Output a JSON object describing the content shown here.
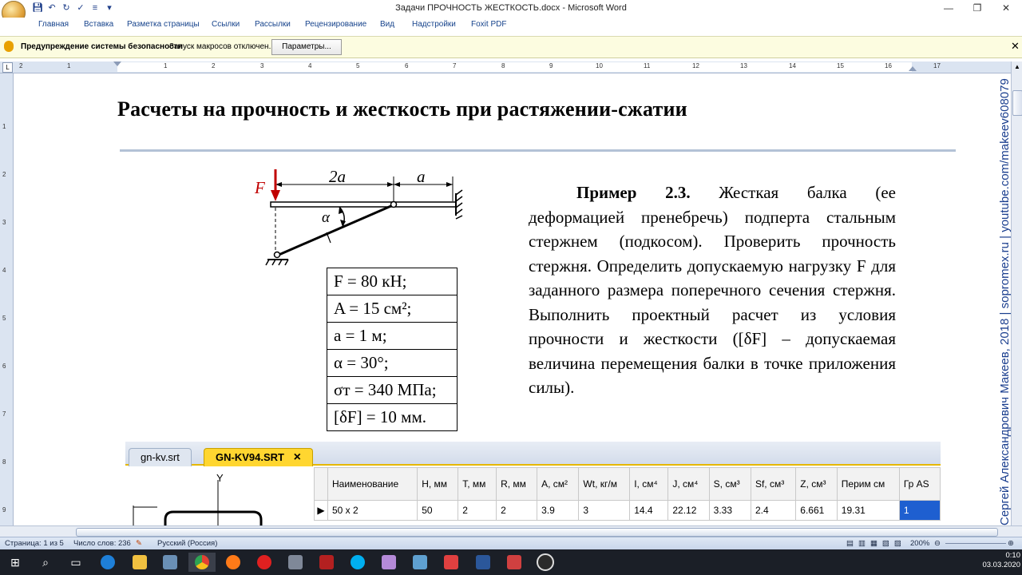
{
  "window": {
    "title": "Задачи ПРОЧНОСТЬ ЖЕСТКОСТЬ.docx - Microsoft Word"
  },
  "ribbon": {
    "tabs": [
      "Главная",
      "Вставка",
      "Разметка страницы",
      "Ссылки",
      "Рассылки",
      "Рецензирование",
      "Вид",
      "Надстройки",
      "Foxit PDF"
    ]
  },
  "security_bar": {
    "title": "Предупреждение системы безопасности",
    "message": "Запуск макросов отключен.",
    "button": "Параметры..."
  },
  "ruler": {
    "numbers": [
      "2",
      "1",
      "1",
      "2",
      "3",
      "4",
      "5",
      "6",
      "7",
      "8",
      "9",
      "10",
      "11",
      "12",
      "13",
      "14",
      "15",
      "16",
      "17"
    ]
  },
  "vruler": {
    "numbers": [
      "1",
      "2",
      "3",
      "4",
      "5",
      "6",
      "7",
      "8",
      "9"
    ]
  },
  "document": {
    "title": "Расчеты на прочность и жесткость при растяжении-сжатии",
    "figure": {
      "force": "F",
      "dim_2a": "2a",
      "dim_a": "a",
      "angle": "α"
    },
    "params": [
      "F = 80 кН;",
      "A = 15 см²;",
      "a = 1 м;",
      "α = 30°;",
      "σт = 340 МПа;",
      "[δF] = 10 мм."
    ],
    "example_label": "Пример 2.3.",
    "example_text": "Жесткая балка (ее деформацией пренебречь) подперта стальным стержнем (подкосом). Проверить прочность стержня. Определить допускаемую нагрузку F для заданного размера поперечного сечения стержня. Выполнить проектный расчет из условия прочности и жесткости ([δF] – допускаемая величина перемещения балки в точке приложения силы)."
  },
  "embedded": {
    "tabs": [
      "gn-kv.srt",
      "GN-KV94.SRT"
    ],
    "close": "×",
    "axis_label": "Y",
    "headers": [
      "Наименование",
      "H, мм",
      "T, мм",
      "R, мм",
      "A, см²",
      "Wt, кг/м",
      "I, см⁴",
      "J, см⁴",
      "S, см³",
      "Sf, см³",
      "Z, см³",
      "Перим см",
      "Гр AS"
    ],
    "row": [
      "50 x 2",
      "50",
      "2",
      "2",
      "3.9",
      "3",
      "14.4",
      "22.12",
      "3.33",
      "2.4",
      "6.661",
      "19.31",
      "1"
    ]
  },
  "watermark": "Сергей Александрович Макеев, 2018 | sopromex.ru | youtube.com/makeev608079",
  "status": {
    "page": "Страница: 1 из 5",
    "words": "Число слов: 236",
    "lang": "Русский (Россия)",
    "zoom": "200%"
  },
  "clock": {
    "time": "0:10",
    "date": "03.03.2020"
  },
  "colors": {
    "accent_tab": "#ffd630",
    "ribbon_text": "#15428b",
    "force_arrow": "#c00000"
  }
}
